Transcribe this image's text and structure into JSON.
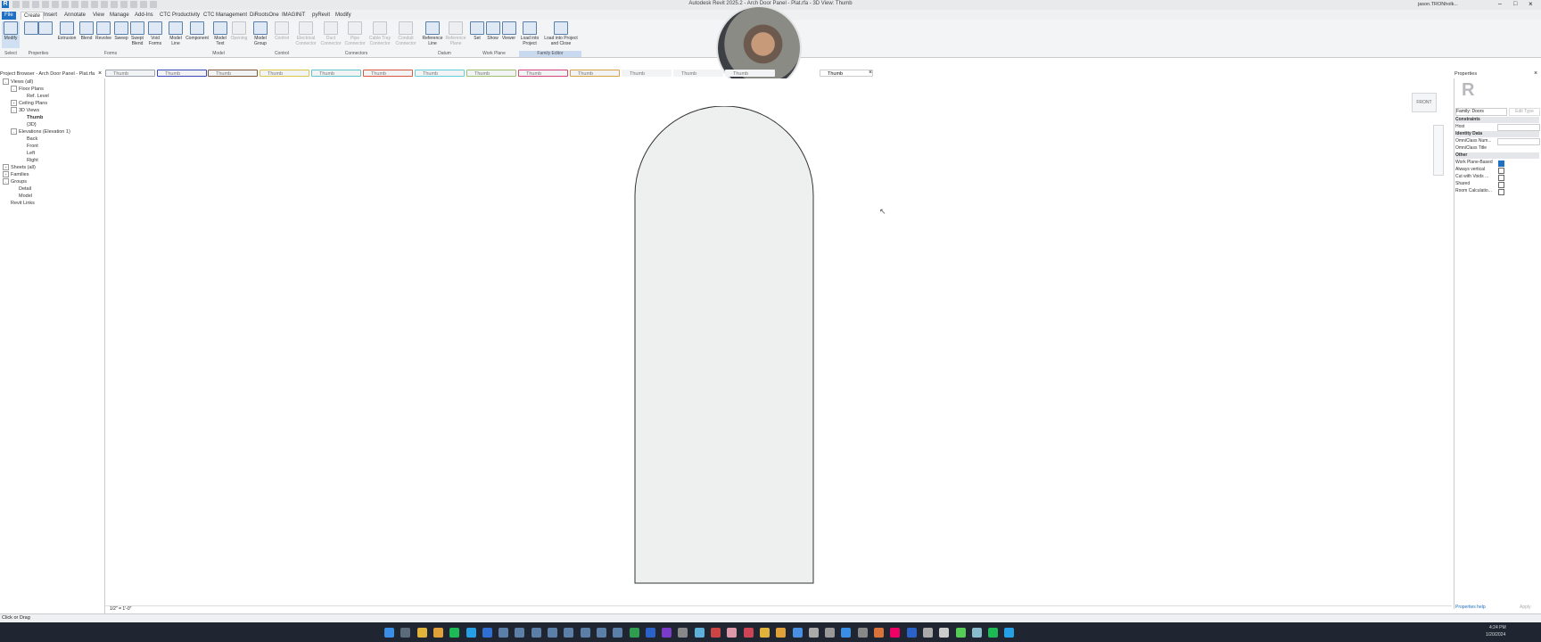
{
  "window": {
    "title": "Autodesk Revit 2025.2 - Arch Door Panel - Plat.rfa - 3D View: Thumb",
    "user": "jason.TRONholk..."
  },
  "menu_tabs": [
    "File",
    "Create",
    "Insert",
    "Annotate",
    "View",
    "Manage",
    "Add-Ins",
    "CTC Productivity",
    "CTC Management",
    "DiRootsOne",
    "IMAGINiT",
    "pyRevit",
    "Modify"
  ],
  "ribbon": {
    "buttons": [
      {
        "label": "Modify",
        "disabled": false
      },
      {
        "label": "Extrusion",
        "disabled": false
      },
      {
        "label": "Blend",
        "disabled": false
      },
      {
        "label": "Revolve",
        "disabled": false
      },
      {
        "label": "Sweep",
        "disabled": false
      },
      {
        "label": "Swept Blend",
        "disabled": false
      },
      {
        "label": "Void Forms",
        "disabled": false
      },
      {
        "label": "Model Line",
        "disabled": false
      },
      {
        "label": "Component",
        "disabled": false
      },
      {
        "label": "Model Text",
        "disabled": false
      },
      {
        "label": "Opening",
        "disabled": true
      },
      {
        "label": "Model Group",
        "disabled": false
      },
      {
        "label": "Control",
        "disabled": true
      },
      {
        "label": "Electrical Connector",
        "disabled": true
      },
      {
        "label": "Duct Connector",
        "disabled": true
      },
      {
        "label": "Pipe Connector",
        "disabled": true
      },
      {
        "label": "Cable Tray Connector",
        "disabled": true
      },
      {
        "label": "Conduit Connector",
        "disabled": true
      },
      {
        "label": "Reference Line",
        "disabled": false
      },
      {
        "label": "Reference Plane",
        "disabled": true
      },
      {
        "label": "Set",
        "disabled": false
      },
      {
        "label": "Show",
        "disabled": false
      },
      {
        "label": "Viewer",
        "disabled": false
      },
      {
        "label": "Load into Project",
        "disabled": false
      },
      {
        "label": "Load into Project and Close",
        "disabled": false
      }
    ],
    "panels": [
      "Select",
      "Properties",
      "Forms",
      "Model",
      "Control",
      "Connectors",
      "Datum",
      "Work Plane",
      "Family Editor"
    ]
  },
  "view_tabs": [
    {
      "label": "Thumb",
      "color": "#9aa3ad"
    },
    {
      "label": "Thumb",
      "color": "#3b47b8"
    },
    {
      "label": "Thumb",
      "color": "#7a5a3a"
    },
    {
      "label": "Thumb",
      "color": "#d8c64a"
    },
    {
      "label": "Thumb",
      "color": "#5fc4c8"
    },
    {
      "label": "Thumb",
      "color": "#d9573a"
    },
    {
      "label": "Thumb",
      "color": "#5fd0d8"
    },
    {
      "label": "Thumb",
      "color": "#9ec26a"
    },
    {
      "label": "Thumb",
      "color": "#d2447a"
    },
    {
      "label": "Thumb",
      "color": "#d7a043"
    },
    {
      "label": "Thumb",
      "color": ""
    },
    {
      "label": "Thumb",
      "color": ""
    },
    {
      "label": "Thumb",
      "color": ""
    },
    {
      "label": "Thumb",
      "color": "",
      "active": true
    }
  ],
  "project_browser": {
    "title": "Project Browser - Arch Door Panel - Plat.rfa",
    "items": [
      {
        "label": "Views (all)",
        "level": 0,
        "toggle": "-"
      },
      {
        "label": "Floor Plans",
        "level": 1,
        "toggle": "-"
      },
      {
        "label": "Ref. Level",
        "level": 2,
        "toggle": ""
      },
      {
        "label": "Ceiling Plans",
        "level": 1,
        "toggle": "+"
      },
      {
        "label": "3D Views",
        "level": 1,
        "toggle": "-"
      },
      {
        "label": "Thumb",
        "level": 2,
        "toggle": "",
        "bold": true
      },
      {
        "label": "{3D}",
        "level": 2,
        "toggle": ""
      },
      {
        "label": "Elevations (Elevation 1)",
        "level": 1,
        "toggle": "-"
      },
      {
        "label": "Back",
        "level": 2,
        "toggle": ""
      },
      {
        "label": "Front",
        "level": 2,
        "toggle": ""
      },
      {
        "label": "Left",
        "level": 2,
        "toggle": ""
      },
      {
        "label": "Right",
        "level": 2,
        "toggle": ""
      },
      {
        "label": "Sheets (all)",
        "level": 0,
        "toggle": "+"
      },
      {
        "label": "Families",
        "level": 0,
        "toggle": "+"
      },
      {
        "label": "Groups",
        "level": 0,
        "toggle": "-"
      },
      {
        "label": "Detail",
        "level": 1,
        "toggle": ""
      },
      {
        "label": "Model",
        "level": 1,
        "toggle": ""
      },
      {
        "label": "Revit Links",
        "level": 0,
        "toggle": ""
      }
    ]
  },
  "viewcube": {
    "label": "FRONT"
  },
  "properties": {
    "title": "Properties",
    "family_type": "Family: Doors",
    "edit_type": "Edit Type",
    "rows": [
      {
        "label": "Constraints",
        "section": true
      },
      {
        "label": "Host",
        "section": false,
        "control": "value"
      },
      {
        "label": "Identity Data",
        "section": true
      },
      {
        "label": "OmniClass Num...",
        "section": false,
        "control": "value"
      },
      {
        "label": "OmniClass Title",
        "section": false,
        "control": "none"
      },
      {
        "label": "Other",
        "section": true
      },
      {
        "label": "Work Plane-Based",
        "section": false,
        "control": "check-on"
      },
      {
        "label": "Always vertical",
        "section": false,
        "control": "check-off"
      },
      {
        "label": "Cut with Voids ...",
        "section": false,
        "control": "check-off"
      },
      {
        "label": "Shared",
        "section": false,
        "control": "check-off"
      },
      {
        "label": "Room Calculatio...",
        "section": false,
        "control": "check-off"
      }
    ],
    "help_link": "Properties help",
    "apply": "Apply"
  },
  "view_control": {
    "scale": "1/2\" = 1'-0\""
  },
  "status": {
    "text": "Click or Drag"
  },
  "clock": {
    "time": "4:24 PM",
    "date": "1/20/2024"
  }
}
